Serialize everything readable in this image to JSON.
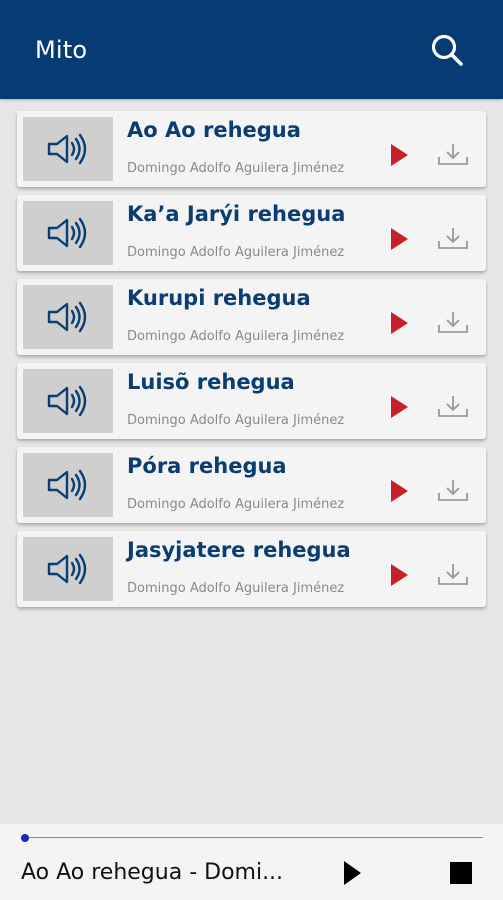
{
  "app_bar": {
    "title": "Mito",
    "search_icon": "search-icon",
    "background": "#063c73"
  },
  "items": [
    {
      "title": "Ao Ao rehegua",
      "author": "Domingo Adolfo Aguilera Jiménez"
    },
    {
      "title": "Ka’a Jarýi rehegua",
      "author": "Domingo Adolfo Aguilera Jiménez"
    },
    {
      "title": "Kurupi rehegua",
      "author": "Domingo Adolfo Aguilera Jiménez"
    },
    {
      "title": "Luisõ rehegua",
      "author": "Domingo Adolfo Aguilera Jiménez"
    },
    {
      "title": "Póra rehegua",
      "author": "Domingo Adolfo Aguilera Jiménez"
    },
    {
      "title": "Jasyjatere rehegua",
      "author": "Domingo Adolfo Aguilera Jiménez"
    }
  ],
  "item_icons": {
    "thumb": "speaker-icon",
    "play": "play-icon",
    "download": "download-icon"
  },
  "player": {
    "now_playing": "Ao Ao rehegua - Domi...",
    "progress": 0
  },
  "colors": {
    "accent_play": "#c8202b",
    "title_text": "#0b3d73",
    "progress_knob": "#1826c8"
  }
}
